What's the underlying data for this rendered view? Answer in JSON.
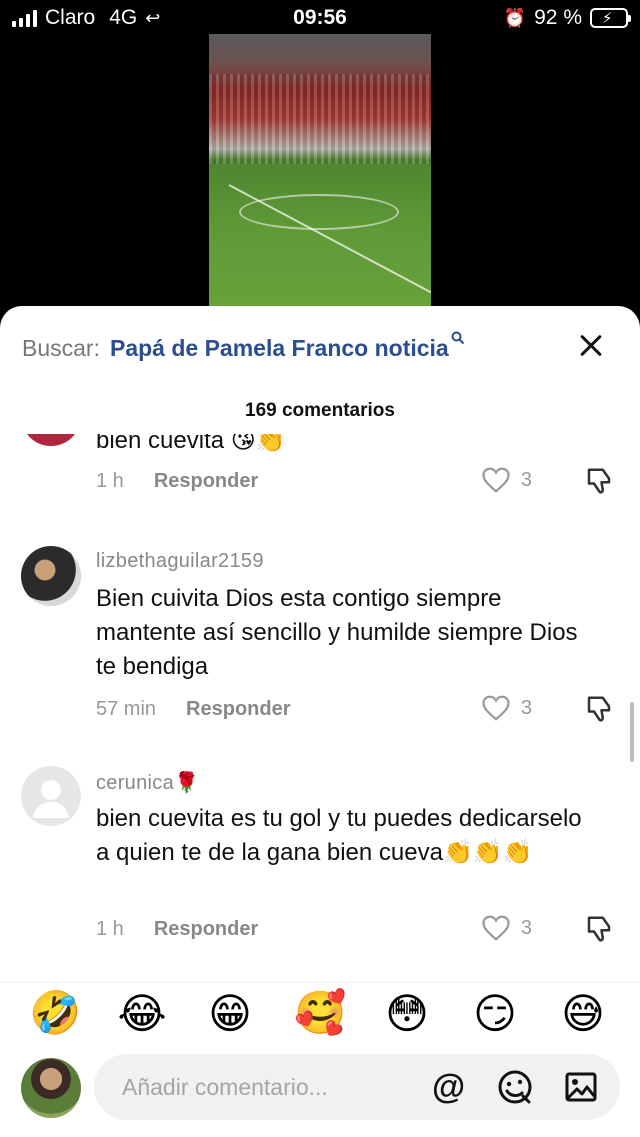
{
  "status_bar": {
    "carrier": "Claro",
    "network": "4G",
    "time": "09:56",
    "battery_percent": "92 %"
  },
  "search": {
    "label": "Buscar:",
    "query": "Papá de Pamela Franco noticia",
    "query_icon": "search-icon"
  },
  "comments_count_label": "169 comentarios",
  "comments": [
    {
      "text": "bien cuevita 😘👏",
      "time": "1 h",
      "reply": "Responder",
      "likes": "3"
    },
    {
      "username": "lizbethaguilar2159",
      "text": "Bien cuivita Dios esta contigo siempre mantente así sencillo y humilde siempre Dios te bendiga",
      "time": "57 min",
      "reply": "Responder",
      "likes": "3"
    },
    {
      "username": "cerunica🌹",
      "text": "bien cuevita es tu gol y tu puedes dedicarselo a quien te de la gana bien cueva👏👏👏",
      "time": "1 h",
      "reply": "Responder",
      "likes": "3"
    }
  ],
  "quick_emojis": [
    "🤣",
    "😂",
    "😁",
    "🥰",
    "😳",
    "😏",
    "😅"
  ],
  "composer": {
    "placeholder": "Añadir comentario...",
    "at_symbol": "@"
  },
  "colors": {
    "accent": "#2a4e8f",
    "battery": "#34c759"
  }
}
